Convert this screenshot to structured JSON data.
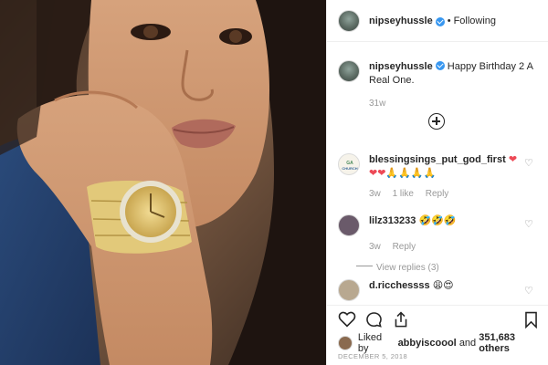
{
  "header": {
    "username": "nipseyhussle",
    "dot": "•",
    "follow_status": "Following"
  },
  "caption": {
    "username": "nipseyhussle",
    "text": "Happy Birthday 2 A Real One.",
    "time": "31w"
  },
  "comments": [
    {
      "username": "blessingsings_put_god_first",
      "text": "❤",
      "second_line": "❤❤🙏🙏🙏🙏",
      "time": "3w",
      "likes": "1 like",
      "reply": "Reply"
    },
    {
      "username": "lilz313233",
      "text": "🤣🤣🤣",
      "time": "3w",
      "reply": "Reply",
      "view_replies": "View replies (3)"
    },
    {
      "username": "d.ricchessss",
      "text": "😩😍"
    }
  ],
  "likes": {
    "prefix": "Liked by",
    "user": "abbyiscoool",
    "and": "and",
    "count": "351,683 others"
  },
  "date": "DECEMBER 5, 2018",
  "colors": {
    "verified": "#3897f0",
    "heart": "#ed4956",
    "muted": "#999999"
  }
}
